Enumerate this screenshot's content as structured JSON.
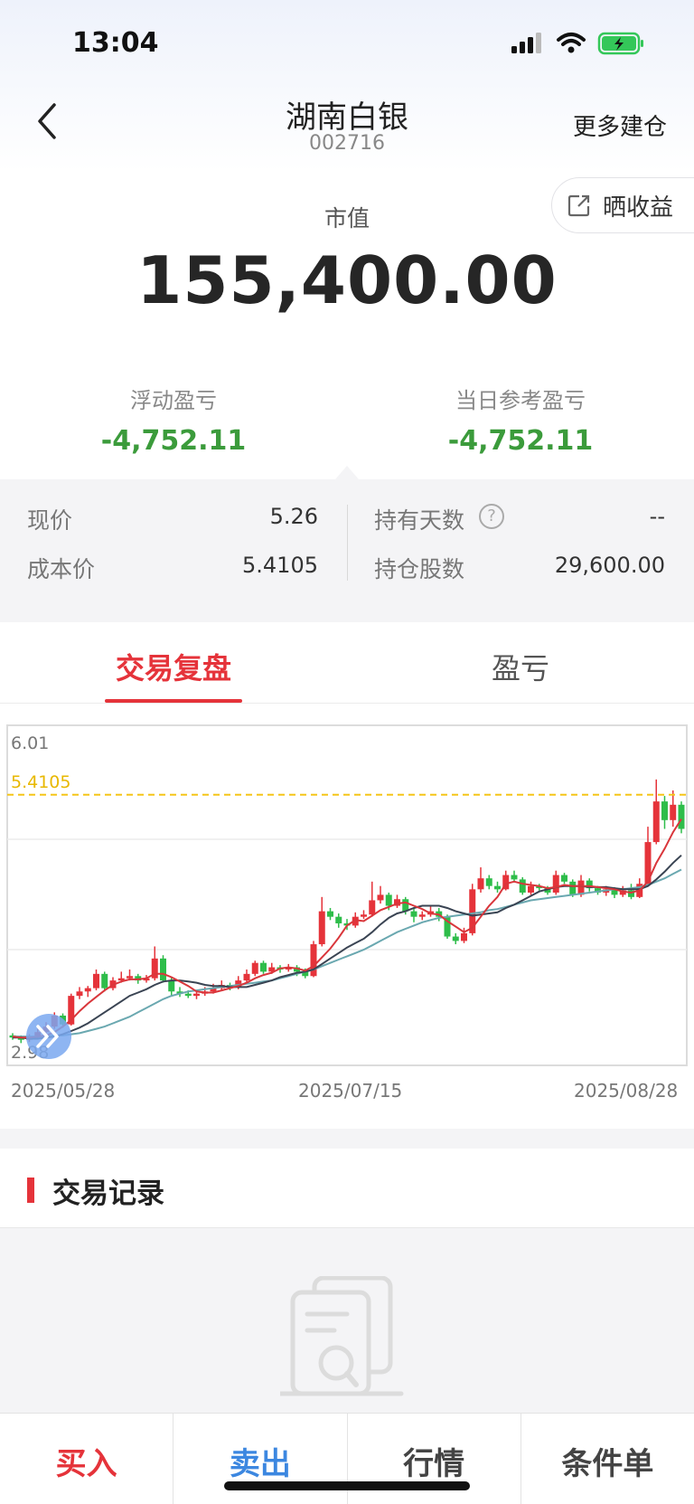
{
  "status_bar": {
    "time": "13:04"
  },
  "nav": {
    "title": "湖南白银",
    "code": "002716",
    "more_label": "更多建仓"
  },
  "market_value": {
    "share_label": "晒收益",
    "label": "市值",
    "value": "155,400.00"
  },
  "pnl": {
    "floating_label": "浮动盈亏",
    "floating_value": "-4,752.11",
    "daily_label": "当日参考盈亏",
    "daily_value": "-4,752.11"
  },
  "stats": {
    "price_label": "现价",
    "price_value": "5.26",
    "cost_label": "成本价",
    "cost_value": "5.4105",
    "days_label": "持有天数",
    "days_value": "--",
    "shares_label": "持仓股数",
    "shares_value": "29,600.00"
  },
  "tabs": [
    {
      "label": "交易复盘",
      "active": true
    },
    {
      "label": "盈亏",
      "active": false
    }
  ],
  "chart_data": {
    "type": "candlestick",
    "ymax_label": "6.01",
    "ymin_label": "2.98",
    "ylim": [
      2.98,
      6.01
    ],
    "cost_line": {
      "label": "5.4105",
      "value": 5.4105,
      "color": "#f5c518"
    },
    "x_labels": [
      "2025/05/28",
      "2025/07/15",
      "2025/08/28"
    ],
    "up_color": "#e5333a",
    "down_color": "#2ebd4a",
    "candles": [
      [
        3.22,
        3.2,
        3.24,
        3.18
      ],
      [
        3.2,
        3.18,
        3.22,
        3.15
      ],
      [
        3.18,
        3.2,
        3.23,
        3.16
      ],
      [
        3.2,
        3.25,
        3.28,
        3.19
      ],
      [
        3.25,
        3.3,
        3.34,
        3.23
      ],
      [
        3.3,
        3.4,
        3.43,
        3.28
      ],
      [
        3.4,
        3.32,
        3.42,
        3.29
      ],
      [
        3.32,
        3.58,
        3.6,
        3.31
      ],
      [
        3.58,
        3.62,
        3.66,
        3.55
      ],
      [
        3.62,
        3.65,
        3.67,
        3.57
      ],
      [
        3.65,
        3.78,
        3.82,
        3.63
      ],
      [
        3.78,
        3.65,
        3.8,
        3.62
      ],
      [
        3.65,
        3.72,
        3.75,
        3.63
      ],
      [
        3.72,
        3.74,
        3.8,
        3.7
      ],
      [
        3.74,
        3.76,
        3.82,
        3.72
      ],
      [
        3.76,
        3.72,
        3.78,
        3.69
      ],
      [
        3.72,
        3.74,
        3.77,
        3.7
      ],
      [
        3.74,
        3.92,
        4.03,
        3.72
      ],
      [
        3.92,
        3.72,
        3.95,
        3.7
      ],
      [
        3.72,
        3.62,
        3.75,
        3.58
      ],
      [
        3.62,
        3.6,
        3.66,
        3.57
      ],
      [
        3.6,
        3.58,
        3.63,
        3.56
      ],
      [
        3.58,
        3.6,
        3.63,
        3.55
      ],
      [
        3.6,
        3.62,
        3.66,
        3.58
      ],
      [
        3.62,
        3.65,
        3.69,
        3.6
      ],
      [
        3.65,
        3.68,
        3.72,
        3.63
      ],
      [
        3.68,
        3.66,
        3.7,
        3.63
      ],
      [
        3.66,
        3.72,
        3.76,
        3.64
      ],
      [
        3.72,
        3.78,
        3.82,
        3.7
      ],
      [
        3.78,
        3.88,
        3.9,
        3.76
      ],
      [
        3.88,
        3.8,
        3.9,
        3.78
      ],
      [
        3.8,
        3.84,
        3.88,
        3.78
      ],
      [
        3.84,
        3.82,
        3.86,
        3.79
      ],
      [
        3.82,
        3.84,
        3.87,
        3.8
      ],
      [
        3.84,
        3.8,
        3.86,
        3.76
      ],
      [
        3.8,
        3.76,
        3.83,
        3.74
      ],
      [
        3.76,
        4.05,
        4.08,
        3.75
      ],
      [
        4.05,
        4.35,
        4.48,
        4.03
      ],
      [
        4.35,
        4.3,
        4.38,
        4.27
      ],
      [
        4.3,
        4.24,
        4.33,
        4.2
      ],
      [
        4.24,
        4.22,
        4.28,
        4.18
      ],
      [
        4.22,
        4.3,
        4.34,
        4.2
      ],
      [
        4.3,
        4.32,
        4.36,
        4.28
      ],
      [
        4.32,
        4.45,
        4.62,
        4.3
      ],
      [
        4.45,
        4.5,
        4.58,
        4.42
      ],
      [
        4.5,
        4.4,
        4.52,
        4.36
      ],
      [
        4.4,
        4.46,
        4.5,
        4.38
      ],
      [
        4.46,
        4.35,
        4.48,
        4.32
      ],
      [
        4.35,
        4.3,
        4.38,
        4.25
      ],
      [
        4.3,
        4.32,
        4.35,
        4.27
      ],
      [
        4.32,
        4.35,
        4.4,
        4.3
      ],
      [
        4.35,
        4.3,
        4.38,
        4.26
      ],
      [
        4.3,
        4.12,
        4.32,
        4.1
      ],
      [
        4.12,
        4.08,
        4.15,
        4.05
      ],
      [
        4.08,
        4.15,
        4.2,
        4.06
      ],
      [
        4.15,
        4.55,
        4.6,
        4.13
      ],
      [
        4.55,
        4.65,
        4.75,
        4.52
      ],
      [
        4.65,
        4.58,
        4.68,
        4.55
      ],
      [
        4.58,
        4.55,
        4.62,
        4.52
      ],
      [
        4.55,
        4.68,
        4.72,
        4.54
      ],
      [
        4.68,
        4.64,
        4.72,
        4.62
      ],
      [
        4.64,
        4.52,
        4.66,
        4.5
      ],
      [
        4.52,
        4.58,
        4.62,
        4.5
      ],
      [
        4.58,
        4.56,
        4.6,
        4.54
      ],
      [
        4.56,
        4.52,
        4.58,
        4.5
      ],
      [
        4.52,
        4.68,
        4.72,
        4.5
      ],
      [
        4.68,
        4.62,
        4.7,
        4.6
      ],
      [
        4.62,
        4.5,
        4.64,
        4.48
      ],
      [
        4.5,
        4.63,
        4.68,
        4.48
      ],
      [
        4.63,
        4.56,
        4.65,
        4.53
      ],
      [
        4.56,
        4.52,
        4.58,
        4.5
      ],
      [
        4.52,
        4.55,
        4.58,
        4.49
      ],
      [
        4.55,
        4.5,
        4.57,
        4.47
      ],
      [
        4.5,
        4.54,
        4.58,
        4.48
      ],
      [
        4.54,
        4.48,
        4.6,
        4.46
      ],
      [
        4.48,
        4.6,
        4.65,
        4.47
      ],
      [
        4.6,
        4.98,
        5.12,
        4.58
      ],
      [
        4.98,
        5.35,
        5.55,
        4.96
      ],
      [
        5.35,
        5.18,
        5.4,
        5.1
      ],
      [
        5.18,
        5.32,
        5.45,
        5.12
      ],
      [
        5.32,
        5.1,
        5.35,
        5.06
      ]
    ],
    "ma5": [
      3.21,
      3.2,
      3.2,
      3.21,
      3.22,
      3.25,
      3.3,
      3.36,
      3.44,
      3.51,
      3.57,
      3.63,
      3.68,
      3.71,
      3.73,
      3.73,
      3.74,
      3.78,
      3.78,
      3.75,
      3.71,
      3.67,
      3.62,
      3.61,
      3.61,
      3.63,
      3.65,
      3.67,
      3.7,
      3.74,
      3.77,
      3.79,
      3.83,
      3.84,
      3.83,
      3.81,
      3.85,
      3.93,
      4.01,
      4.11,
      4.22,
      4.27,
      4.26,
      4.31,
      4.36,
      4.39,
      4.42,
      4.43,
      4.4,
      4.37,
      4.33,
      4.32,
      4.26,
      4.21,
      4.16,
      4.2,
      4.3,
      4.4,
      4.48,
      4.6,
      4.62,
      4.6,
      4.59,
      4.58,
      4.56,
      4.57,
      4.59,
      4.58,
      4.58,
      4.58,
      4.57,
      4.56,
      4.55,
      4.53,
      4.52,
      4.54,
      4.62,
      4.79,
      4.92,
      5.07,
      5.19
    ],
    "ma10": [
      3.2,
      3.2,
      3.19,
      3.19,
      3.2,
      3.21,
      3.23,
      3.26,
      3.29,
      3.33,
      3.38,
      3.43,
      3.48,
      3.53,
      3.58,
      3.61,
      3.64,
      3.68,
      3.71,
      3.72,
      3.72,
      3.71,
      3.7,
      3.68,
      3.67,
      3.67,
      3.66,
      3.66,
      3.66,
      3.68,
      3.7,
      3.72,
      3.75,
      3.77,
      3.79,
      3.8,
      3.82,
      3.87,
      3.92,
      3.97,
      4.02,
      4.06,
      4.1,
      4.16,
      4.23,
      4.29,
      4.33,
      4.35,
      4.38,
      4.4,
      4.4,
      4.4,
      4.38,
      4.35,
      4.33,
      4.31,
      4.32,
      4.33,
      4.34,
      4.38,
      4.41,
      4.45,
      4.49,
      4.53,
      4.55,
      4.57,
      4.58,
      4.58,
      4.58,
      4.57,
      4.57,
      4.57,
      4.56,
      4.55,
      4.55,
      4.55,
      4.58,
      4.64,
      4.71,
      4.79,
      4.86
    ],
    "ma20": [
      3.21,
      3.21,
      3.21,
      3.21,
      3.21,
      3.22,
      3.22,
      3.23,
      3.24,
      3.26,
      3.28,
      3.3,
      3.33,
      3.36,
      3.39,
      3.43,
      3.47,
      3.51,
      3.55,
      3.58,
      3.6,
      3.62,
      3.63,
      3.64,
      3.65,
      3.66,
      3.67,
      3.68,
      3.69,
      3.7,
      3.71,
      3.72,
      3.74,
      3.76,
      3.78,
      3.8,
      3.82,
      3.85,
      3.88,
      3.91,
      3.94,
      3.97,
      4.0,
      4.04,
      4.08,
      4.12,
      4.16,
      4.19,
      4.22,
      4.25,
      4.27,
      4.29,
      4.3,
      4.31,
      4.32,
      4.33,
      4.34,
      4.36,
      4.37,
      4.39,
      4.41,
      4.43,
      4.45,
      4.46,
      4.47,
      4.48,
      4.49,
      4.5,
      4.51,
      4.52,
      4.53,
      4.54,
      4.55,
      4.55,
      4.56,
      4.57,
      4.59,
      4.62,
      4.65,
      4.69,
      4.73
    ]
  },
  "records": {
    "title": "交易记录"
  },
  "bottom_bar": {
    "buy": "买入",
    "sell": "卖出",
    "market": "行情",
    "conditional": "条件单"
  }
}
